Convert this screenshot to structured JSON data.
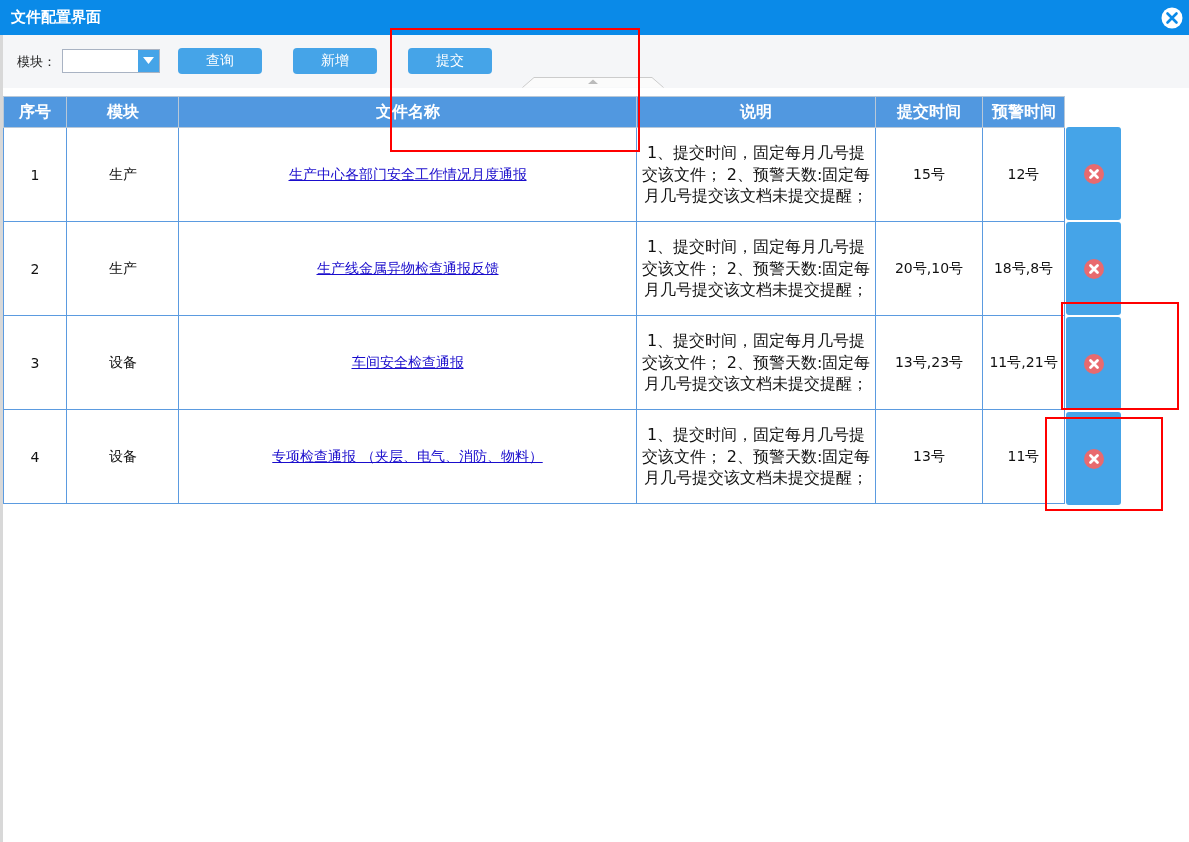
{
  "window": {
    "title": "文件配置界面"
  },
  "filter": {
    "label": "模块："
  },
  "toolbar_buttons": [
    {
      "label": "查询",
      "highlighted": false
    },
    {
      "label": "新增",
      "highlighted": false
    },
    {
      "label": "提交",
      "highlighted": true
    }
  ],
  "table": {
    "columns": [
      "序号",
      "模块",
      "文件名称",
      "说明",
      "提交时间",
      "预警时间"
    ],
    "rows": [
      {
        "no": "1",
        "module": "生产",
        "file": "生产中心各部门安全工作情况月度通报",
        "note": "1、提交时间，固定每月几号提交该文件； 2、预警天数:固定每月几号提交该文档未提交提醒；",
        "submit": "15号",
        "warn": "12号",
        "highlighted": false
      },
      {
        "no": "2",
        "module": "生产",
        "file": "生产线金属异物检查通报反馈",
        "note": "1、提交时间，固定每月几号提交该文件； 2、预警天数:固定每月几号提交该文档未提交提醒；",
        "submit": "20号,10号",
        "warn": "18号,8号",
        "highlighted": false
      },
      {
        "no": "3",
        "module": "设备",
        "file": "车间安全检查通报",
        "note": "1、提交时间，固定每月几号提交该文件； 2、预警天数:固定每月几号提交该文档未提交提醒；",
        "submit": "13号,23号",
        "warn": "11号,21号",
        "highlighted": true
      },
      {
        "no": "4",
        "module": "设备",
        "file": "专项检查通报 （夹层、电气、消防、物料）",
        "note": "1、提交时间，固定每月几号提交该文件； 2、预警天数:固定每月几号提交该文档未提交提醒；",
        "submit": "13号",
        "warn": "11号",
        "highlighted": true
      }
    ]
  }
}
